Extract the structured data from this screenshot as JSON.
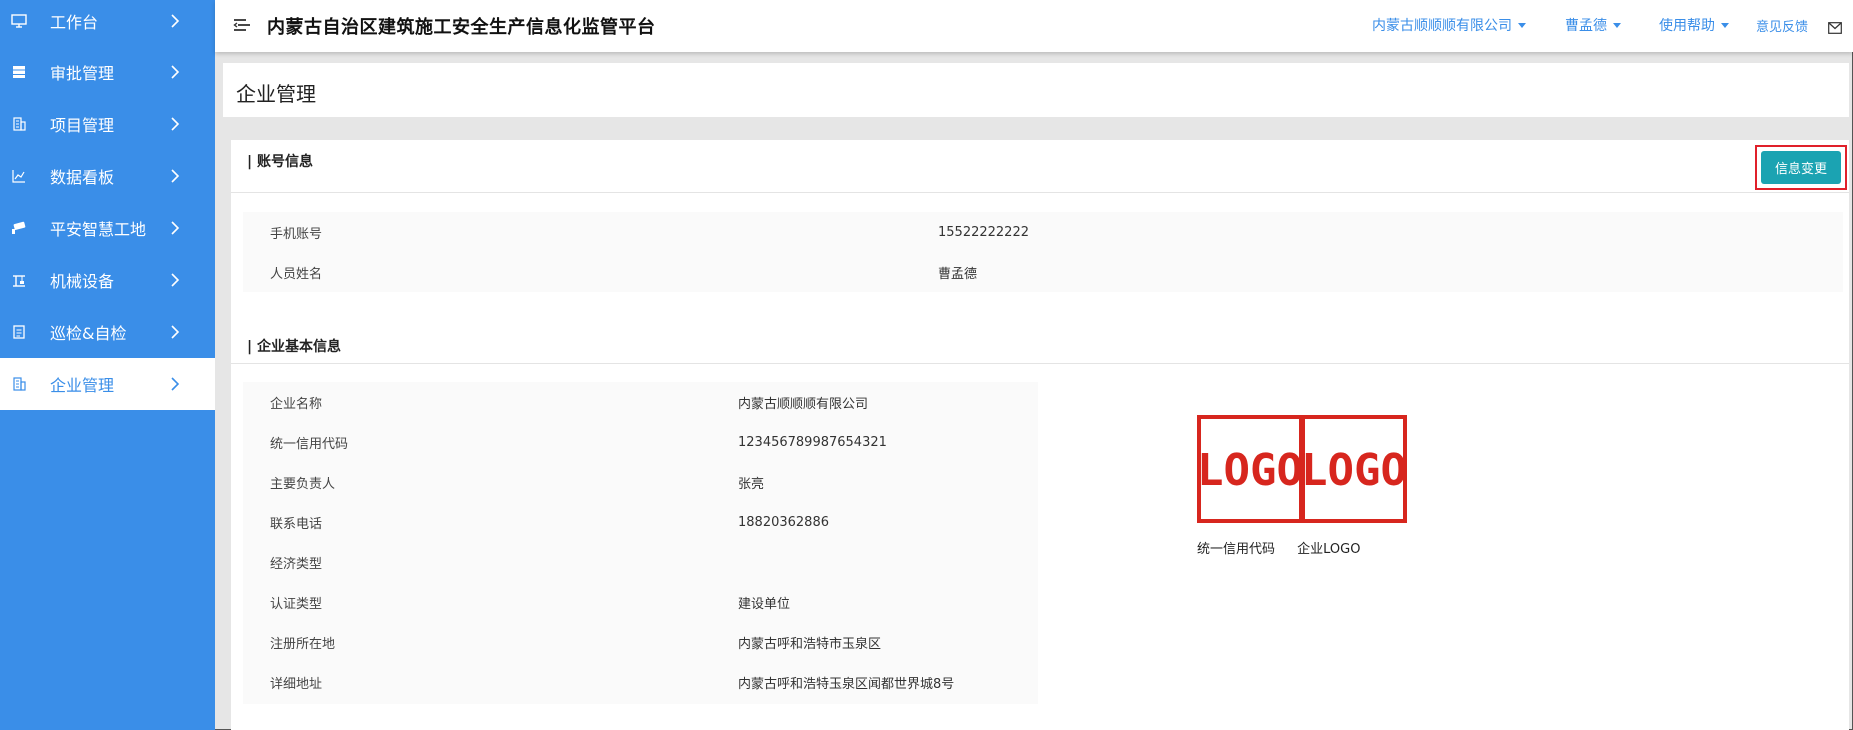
{
  "sidebar": {
    "items": [
      {
        "label": "工作台",
        "icon": "monitor-icon"
      },
      {
        "label": "审批管理",
        "icon": "server-icon"
      },
      {
        "label": "项目管理",
        "icon": "building-icon"
      },
      {
        "label": "数据看板",
        "icon": "chart-icon"
      },
      {
        "label": "平安智慧工地",
        "icon": "camera-icon"
      },
      {
        "label": "机械设备",
        "icon": "crane-icon"
      },
      {
        "label": "巡检&自检",
        "icon": "clipboard-icon"
      },
      {
        "label": "企业管理",
        "icon": "building-icon",
        "active": true
      }
    ]
  },
  "header": {
    "title": "内蒙古自治区建筑施工安全生产信息化监管平台",
    "company": "内蒙古顺顺顺有限公司",
    "user": "曹孟德",
    "help": "使用帮助",
    "feedback": "意见反馈"
  },
  "page": {
    "title": "企业管理"
  },
  "account": {
    "section_title": "| 账号信息",
    "change_button": "信息变更",
    "rows": [
      {
        "key": "手机账号",
        "value": "15522222222"
      },
      {
        "key": "人员姓名",
        "value": "曹孟德"
      }
    ]
  },
  "enterprise": {
    "section_title": "| 企业基本信息",
    "rows": [
      {
        "key": "企业名称",
        "value": "内蒙古顺顺顺有限公司"
      },
      {
        "key": "统一信用代码",
        "value": "123456789987654321"
      },
      {
        "key": "主要负责人",
        "value": "张亮"
      },
      {
        "key": "联系电话",
        "value": "18820362886"
      },
      {
        "key": "经济类型",
        "value": ""
      },
      {
        "key": "认证类型",
        "value": "建设单位"
      },
      {
        "key": "注册所在地",
        "value": "内蒙古呼和浩特市玉泉区"
      },
      {
        "key": "详细地址",
        "value": "内蒙古呼和浩特玉泉区闻都世界城8号"
      }
    ],
    "logo_text_left": "LOGO",
    "logo_text_right": "LOGO",
    "caption_credit": "统一信用代码",
    "caption_logo": "企业LOGO"
  },
  "colors": {
    "sidebar": "#3a8ee8",
    "button": "#1ba3b2",
    "highlight": "#e0202a",
    "logo": "#d7261e"
  }
}
